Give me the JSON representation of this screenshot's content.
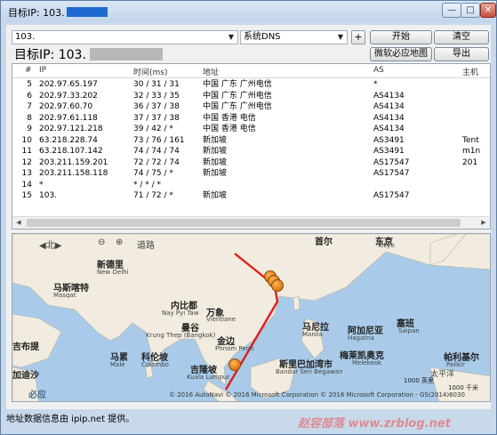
{
  "window": {
    "title": "目标IP: 103.",
    "min_label": "—",
    "max_label": "□",
    "close_label": "✕"
  },
  "toolbar": {
    "ip_value": "103.",
    "dns_value": "系统DNS",
    "plus_label": "+",
    "start_label": "开始",
    "clear_label": "清空",
    "map_label": "微软必应地图",
    "export_label": "导出",
    "dropdown_arrow": "▼"
  },
  "target": {
    "label": "目标IP:  103."
  },
  "table": {
    "headers": [
      "#",
      "IP",
      "时间(ms)",
      "地址",
      "AS",
      "主机"
    ],
    "rows": [
      [
        "5",
        "202.97.65.197",
        "30 / 31 / 31",
        "中国 广东 广州电信",
        "*",
        ""
      ],
      [
        "6",
        "202.97.33.202",
        "32 / 33 / 35",
        "中国 广东 广州电信",
        "AS4134",
        ""
      ],
      [
        "7",
        "202.97.60.70",
        "36 / 37 / 38",
        "中国 广东 广州电信",
        "AS4134",
        ""
      ],
      [
        "8",
        "202.97.61.118",
        "37 / 37 / 38",
        "中国 香港 电信",
        "AS4134",
        ""
      ],
      [
        "9",
        "202.97.121.218",
        "39 / 42 / *",
        "中国 香港 电信",
        "AS4134",
        ""
      ],
      [
        "10",
        "63.218.228.74",
        "73 / 76 / 161",
        "新加坡",
        "AS3491",
        "Tent"
      ],
      [
        "11",
        "63.218.107.142",
        "74 / 74 / 74",
        "新加坡",
        "AS3491",
        "m1n"
      ],
      [
        "12",
        "203.211.159.201",
        "72 / 72 / 74",
        "新加坡",
        "AS17547",
        "201"
      ],
      [
        "13",
        "203.211.158.118",
        "74 / 75 / *",
        "新加坡",
        "AS17547",
        ""
      ],
      [
        "14",
        "*",
        "* / * / *",
        "",
        "",
        ""
      ],
      [
        "15",
        "103.",
        "71 / 72 / *",
        "新加坡",
        "AS17547",
        ""
      ]
    ]
  },
  "map": {
    "controls": {
      "north": "北",
      "zoom_out": "⊖",
      "zoom_in": "⊕",
      "road": "道路",
      "bing": "必应"
    },
    "labels": [
      {
        "text": "新德里",
        "sub": "New Delhi"
      },
      {
        "text": "马斯喀特",
        "sub": "Masqat"
      },
      {
        "text": "内比都",
        "sub": "Nay Pyi Taw"
      },
      {
        "text": "万象",
        "sub": "Vientiane"
      },
      {
        "text": "曼谷",
        "sub": "Krung Thep (Bangkok)"
      },
      {
        "text": "金边",
        "sub": "Phnom Penh"
      },
      {
        "text": "马累",
        "sub": "Male"
      },
      {
        "text": "科伦坡",
        "sub": "Colombo"
      },
      {
        "text": "吉隆坡",
        "sub": "Kuala Lumpur"
      },
      {
        "text": "斯里巴加湾市",
        "sub": "Bandar Seri Begawan"
      },
      {
        "text": "马尼拉",
        "sub": "Manila"
      },
      {
        "text": "阿加尼亚",
        "sub": "Hagatna"
      },
      {
        "text": "塞班",
        "sub": "Saipan"
      },
      {
        "text": "梅莱凯奥克",
        "sub": "Melekeok"
      },
      {
        "text": "帕利基尔",
        "sub": "Palikir"
      },
      {
        "text": "东京",
        "sub": "Tokyo"
      },
      {
        "text": "首尔",
        "sub": ""
      },
      {
        "text": "加迪沙",
        "sub": ""
      },
      {
        "text": "吉布提",
        "sub": ""
      },
      {
        "text": "太平洋",
        "sub": ""
      }
    ],
    "copyright": "© 2016 AutoNavi   © 2016 Microsoft Corporation   © 2016 Microsoft Corporation - GS(2014)6030",
    "scale_miles": "1000 英里",
    "scale_km": "1000 千米",
    "route_color": "#e31b1b"
  },
  "status": {
    "text": "地址数据信息由 ipip.net 提供。"
  },
  "watermark": {
    "text": "赵容部落 www.zrblog.net"
  }
}
